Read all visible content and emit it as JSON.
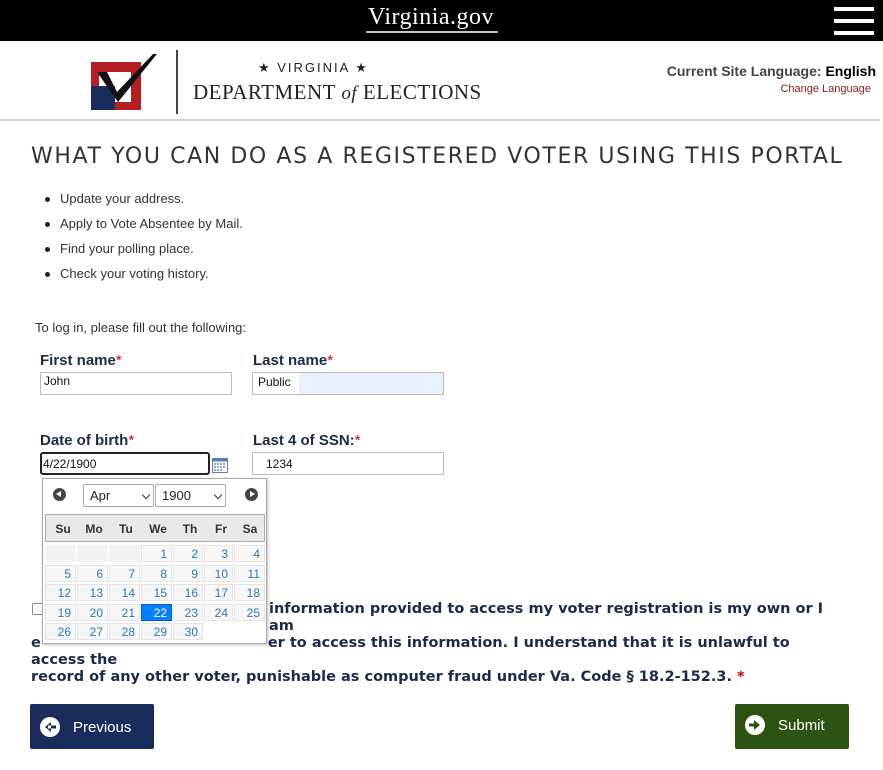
{
  "topbar": {
    "brand": "Virginia.gov"
  },
  "header": {
    "dept_line1": "★ VIRGINIA ★",
    "dept_line2_a": "DEPARTMENT",
    "dept_line2_of": "of",
    "dept_line2_b": "ELECTIONS",
    "language_label": "Current Site Language:",
    "language_value": "English",
    "change_language": "Change Language"
  },
  "page": {
    "title": "WHAT YOU CAN DO AS A REGISTERED VOTER USING THIS PORTAL",
    "bullets": [
      "Update your address.",
      "Apply to Vote Absentee by Mail.",
      "Find your polling place.",
      "Check your voting history."
    ],
    "login_intro": "To log in, please fill out the following:"
  },
  "form": {
    "first_name_label": "First name",
    "first_name_value": "John",
    "last_name_label": "Last name",
    "last_name_value": "Public",
    "dob_label": "Date of birth",
    "dob_value": "4/22/1900",
    "ssn_label": "Last 4 of SSN:",
    "ssn_value": "1234",
    "required_mark": "*"
  },
  "datepicker": {
    "month": "Apr",
    "year": "1900",
    "days_of_week": [
      "Su",
      "Mo",
      "Tu",
      "We",
      "Th",
      "Fr",
      "Sa"
    ],
    "weeks": [
      [
        "",
        "",
        "",
        "1",
        "2",
        "3",
        "4"
      ],
      [
        "5",
        "6",
        "7",
        "8",
        "9",
        "10",
        "11"
      ],
      [
        "12",
        "13",
        "14",
        "15",
        "16",
        "17",
        "18"
      ],
      [
        "19",
        "20",
        "21",
        "22",
        "23",
        "24",
        "25"
      ],
      [
        "26",
        "27",
        "28",
        "29",
        "30",
        "",
        ""
      ]
    ],
    "selected_day": "22"
  },
  "consent": {
    "line1_visible": "information provided to access my voter registration is my own or I am",
    "line2_visible_a": "e",
    "line2_visible_b": "er to access this information. I understand that it is unlawful to access the",
    "line3_visible": "record of any other voter, punishable as computer fraud under Va. Code § 18.2-152.3.",
    "required_mark": "*"
  },
  "buttons": {
    "previous": "Previous",
    "submit": "Submit"
  },
  "colors": {
    "primary_nav": "#1a2c5b",
    "submit_green": "#2d5312",
    "label_navy": "#1c2b4a",
    "required_red": "#cc0000",
    "link_red": "#8b1a1a",
    "selected_blue": "#007fff"
  },
  "icons": {
    "menu": "hamburger-icon",
    "calendar": "calendar-icon",
    "prev": "arrow-left-icon",
    "next": "arrow-right-icon"
  }
}
